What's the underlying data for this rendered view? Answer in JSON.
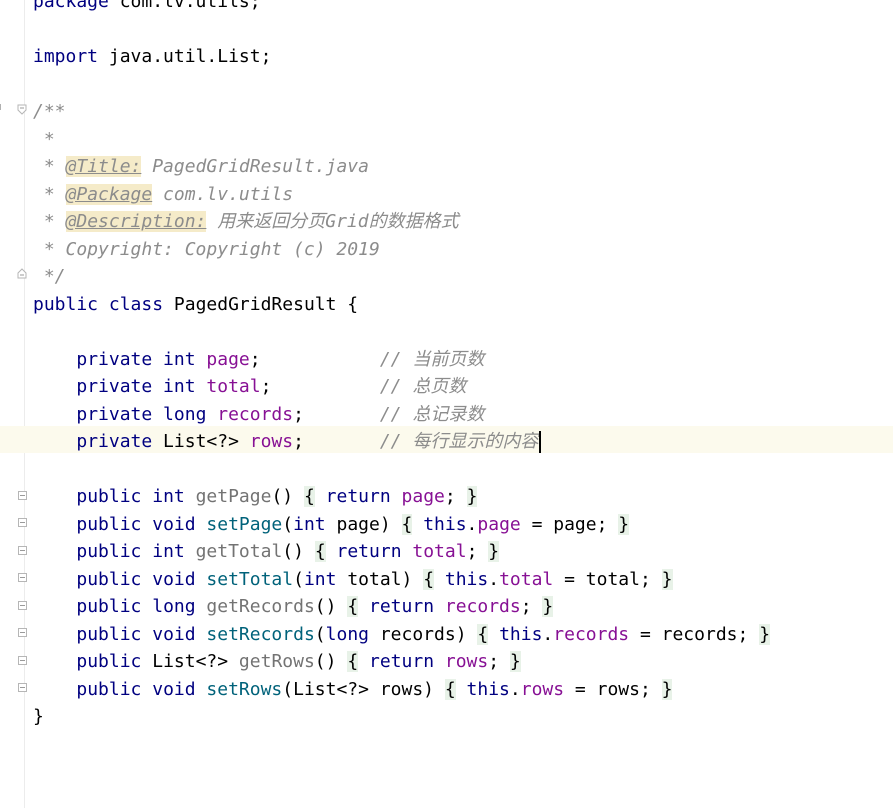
{
  "code": {
    "package_kw": "package",
    "package_name": " com.lv.utils;",
    "import_kw": "import",
    "import_name": " java.util.List;",
    "doc_open": "/**",
    "doc_star": " *",
    "doc_title_prefix": " * ",
    "doc_title_tag": "@Title:",
    "doc_title_value": " PagedGridResult.java",
    "doc_package_prefix": " * ",
    "doc_package_tag": "@Package",
    "doc_package_value": " com.lv.utils",
    "doc_desc_prefix": " * ",
    "doc_desc_tag": "@Description:",
    "doc_desc_value": " 用来返回分页Grid的数据格式",
    "doc_copyright": " * Copyright: Copyright (c) 2019",
    "doc_close": " */",
    "class_public": "public",
    "class_kw": " class",
    "class_name": " PagedGridResult {",
    "fields": [
      {
        "mod": "private",
        "type": " int",
        "name": " page",
        "semi": ";",
        "pad": "           ",
        "comment": "// 当前页数"
      },
      {
        "mod": "private",
        "type": " int",
        "name": " total",
        "semi": ";",
        "pad": "          ",
        "comment": "// 总页数"
      },
      {
        "mod": "private",
        "type": " long",
        "name": " records",
        "semi": ";",
        "pad": "       ",
        "comment": "// 总记录数"
      },
      {
        "mod": "private",
        "type": " List<?>",
        "name": " rows",
        "semi": ";",
        "pad": "       ",
        "comment": "// 每行显示的内容"
      }
    ],
    "methods": [
      {
        "mod": "public",
        "type": " int",
        "name": " getPage",
        "params": "()",
        "body_open": "{",
        "body_kw": " return",
        "body_field": " page",
        "body_rest": ";",
        "body_close": "}",
        "getter": true
      },
      {
        "mod": "public",
        "type": " void",
        "name": " setPage",
        "params_open": "(",
        "param_type": "int",
        "param_name": " page",
        "params_close": ")",
        "body_open": "{",
        "body_kw": " this",
        "body_dot": ".",
        "body_field": "page",
        "body_rest": " = page;",
        "body_close": "}",
        "getter": false
      },
      {
        "mod": "public",
        "type": " int",
        "name": " getTotal",
        "params": "()",
        "body_open": "{",
        "body_kw": " return",
        "body_field": " total",
        "body_rest": ";",
        "body_close": "}",
        "getter": true
      },
      {
        "mod": "public",
        "type": " void",
        "name": " setTotal",
        "params_open": "(",
        "param_type": "int",
        "param_name": " total",
        "params_close": ")",
        "body_open": "{",
        "body_kw": " this",
        "body_dot": ".",
        "body_field": "total",
        "body_rest": " = total;",
        "body_close": "}",
        "getter": false
      },
      {
        "mod": "public",
        "type": " long",
        "name": " getRecords",
        "params": "()",
        "body_open": "{",
        "body_kw": " return",
        "body_field": " records",
        "body_rest": ";",
        "body_close": "}",
        "getter": true
      },
      {
        "mod": "public",
        "type": " void",
        "name": " setRecords",
        "params_open": "(",
        "param_type": "long",
        "param_name": " records",
        "params_close": ")",
        "body_open": "{",
        "body_kw": " this",
        "body_dot": ".",
        "body_field": "records",
        "body_rest": " = records;",
        "body_close": "}",
        "getter": false
      },
      {
        "mod": "public",
        "type": " List<?>",
        "name": " getRows",
        "params": "()",
        "body_open": "{",
        "body_kw": " return",
        "body_field": " rows",
        "body_rest": ";",
        "body_close": "}",
        "getter": true
      },
      {
        "mod": "public",
        "type": " void",
        "name": " setRows",
        "params_open": "(",
        "param_type": "List<?>",
        "param_name": " rows",
        "params_close": ")",
        "body_open": "{",
        "body_kw": " this",
        "body_dot": ".",
        "body_field": "rows",
        "body_rest": " = rows;",
        "body_close": "}",
        "getter": false
      }
    ],
    "class_close": "}"
  },
  "colors": {
    "keyword": "#000080",
    "field": "#871094",
    "method": "#00627a",
    "comment": "#8c8c8c",
    "doc_tag_bg": "#f5ebc9",
    "current_line_bg": "#fcfaed",
    "brace_highlight_bg": "#e8f2e8"
  },
  "icons": {
    "gutter_fold": "fold-minus-icon",
    "gutter_doc_fold": "doc-fold-icon"
  }
}
